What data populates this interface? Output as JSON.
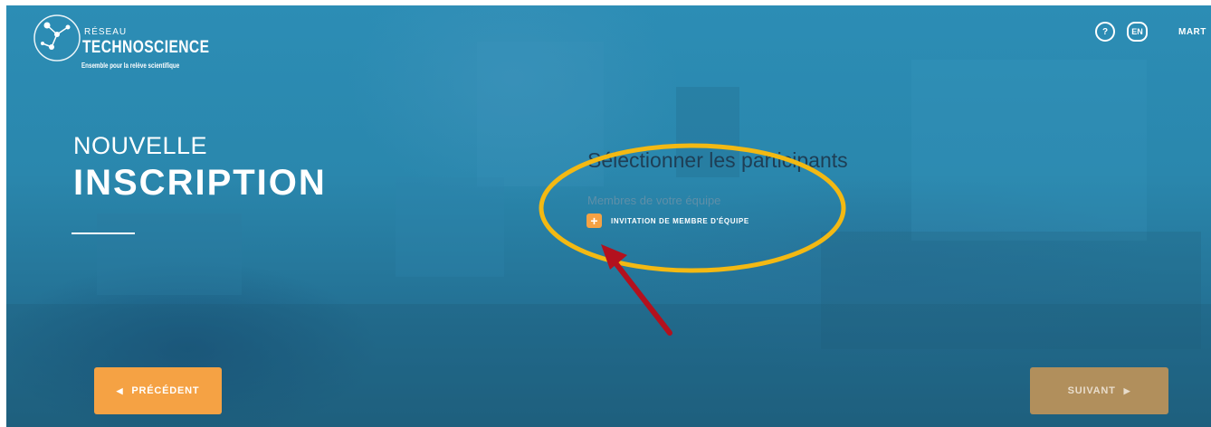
{
  "header": {
    "logo": {
      "supertitle": "RÉSEAU",
      "name": "TECHNOSCIENCE",
      "tagline": "Ensemble pour la relève scientifique"
    },
    "help_label": "?",
    "lang_label": "EN",
    "user_name": "MART"
  },
  "hero": {
    "title_light": "NOUVELLE",
    "title_bold": "INSCRIPTION"
  },
  "main": {
    "section_title": "Sélectionner les participants",
    "team_label": "Membres de votre équipe",
    "invite_icon": "+",
    "invite_label": "INVITATION DE MEMBRE D'ÉQUIPE"
  },
  "nav": {
    "prev_label": "PRÉCÉDENT",
    "prev_icon": "◀",
    "next_label": "SUIVANT",
    "next_icon": "▶"
  },
  "colors": {
    "background": "#2a87ad",
    "accent_orange": "#f5a244",
    "next_disabled": "#b18f5c",
    "annotation_ellipse": "#f3b913",
    "annotation_arrow": "#b3111e"
  }
}
